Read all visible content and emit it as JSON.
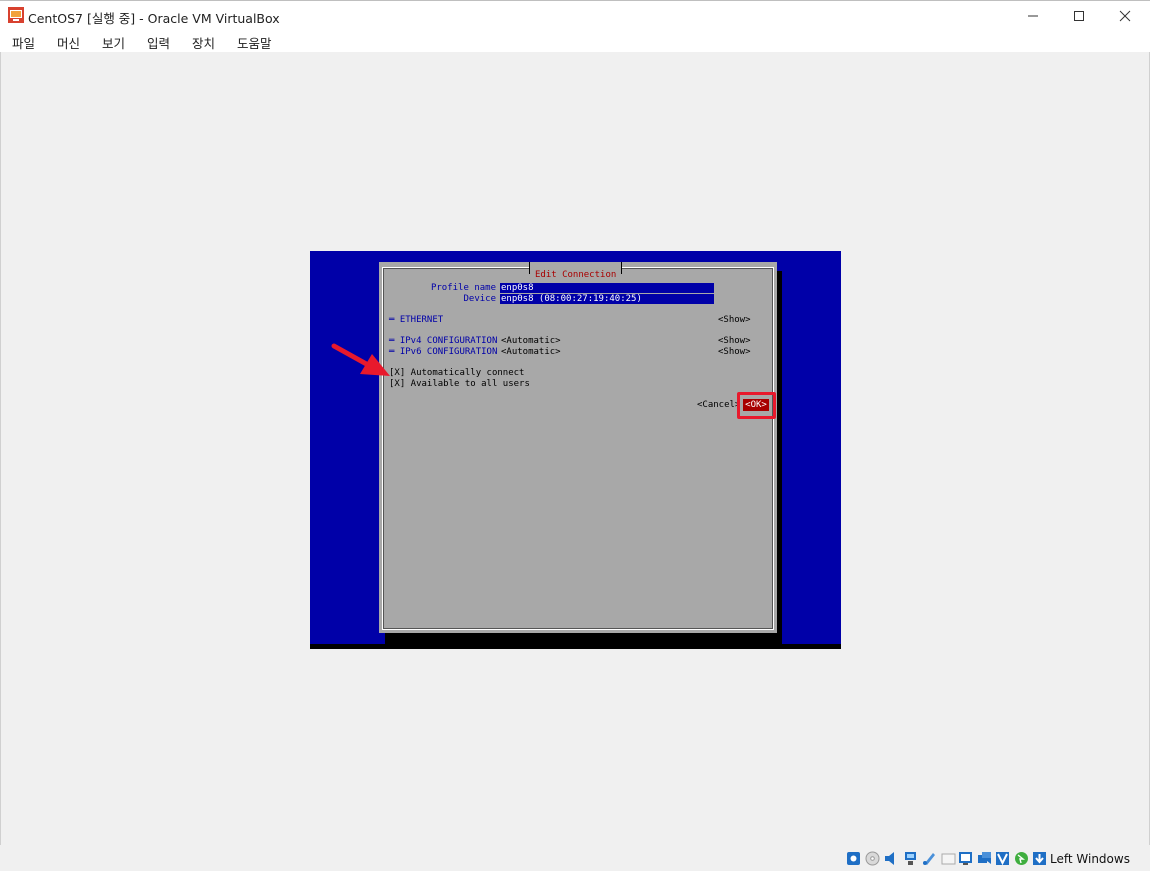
{
  "window": {
    "title": "CentOS7 [실행 중] - Oracle VM VirtualBox",
    "minimize_glyph": "—",
    "maximize_glyph": "☐",
    "close_glyph": "✕"
  },
  "menubar": {
    "items": [
      "파일",
      "머신",
      "보기",
      "입력",
      "장치",
      "도움말"
    ]
  },
  "dialog": {
    "title": "Edit Connection",
    "profile_name_label": "Profile name",
    "profile_name_value": "enp0s8",
    "device_label": "Device",
    "device_value": "enp0s8 (08:00:27:19:40:25)",
    "ethernet_label": "═ ETHERNET",
    "ethernet_button": "<Show>",
    "ipv4_label": "═ IPv4 CONFIGURATION",
    "ipv4_mode": "<Automatic>",
    "ipv4_button": "<Show>",
    "ipv6_label": "═ IPv6 CONFIGURATION",
    "ipv6_mode": "<Automatic>",
    "ipv6_button": "<Show>",
    "auto_connect": "[X] Automatically connect",
    "all_users": "[X] Available to all users",
    "cancel_button": "<Cancel>",
    "ok_button": "<OK>"
  },
  "statusbar": {
    "host_key": "Left Windows",
    "icons": [
      "harddisk-icon",
      "optical-drive-icon",
      "audio-icon",
      "network-icon",
      "usb-icon",
      "shared-folders-icon",
      "display-icon",
      "recording-icon",
      "virtualization-icon",
      "mouse-integration-icon",
      "keyboard-capture-icon"
    ]
  },
  "colors": {
    "console_blue": "#0000a8",
    "dialog_gray": "#a8a8a8",
    "title_red": "#a80000",
    "highlight_red": "#e8192c"
  }
}
